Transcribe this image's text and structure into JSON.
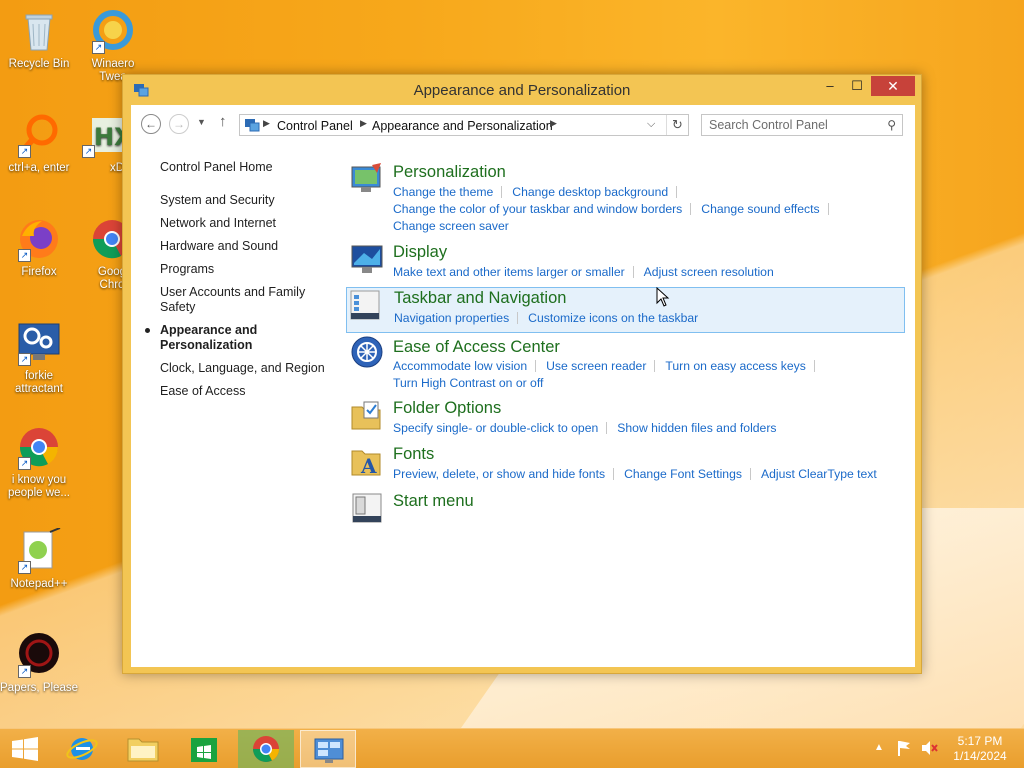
{
  "desktop": {
    "icons": [
      {
        "label": "Recycle Bin"
      },
      {
        "label": "Winaero Twea"
      },
      {
        "label": "ctrl+a, enter"
      },
      {
        "label": "xD"
      },
      {
        "label": "Firefox"
      },
      {
        "label": "Goog Chro"
      },
      {
        "label": "forkie attractant"
      },
      {
        "label": "i know you people we..."
      },
      {
        "label": "Notepad++"
      },
      {
        "label": "Papers, Please"
      }
    ]
  },
  "window": {
    "title": "Appearance and Personalization",
    "buttons": {
      "minimize": "–",
      "maximize": "☐",
      "close": "✕"
    }
  },
  "navbar": {
    "breadcrumbs": [
      "Control Panel",
      "Appearance and Personalization"
    ],
    "search_placeholder": "Search Control Panel"
  },
  "sidebar": {
    "home": "Control Panel Home",
    "items": [
      {
        "label": "System and Security"
      },
      {
        "label": "Network and Internet"
      },
      {
        "label": "Hardware and Sound"
      },
      {
        "label": "Programs"
      },
      {
        "label": "User Accounts and Family Safety"
      },
      {
        "label": "Appearance and Personalization",
        "current": true
      },
      {
        "label": "Clock, Language, and Region"
      },
      {
        "label": "Ease of Access"
      }
    ]
  },
  "categories": [
    {
      "title": "Personalization",
      "icon": "personalization-icon",
      "links": [
        "Change the theme",
        "Change desktop background",
        "Change the color of your taskbar and window borders",
        "Change sound effects",
        "Change screen saver"
      ]
    },
    {
      "title": "Display",
      "icon": "display-icon",
      "links": [
        "Make text and other items larger or smaller",
        "Adjust screen resolution"
      ]
    },
    {
      "title": "Taskbar and Navigation",
      "icon": "taskbar-icon",
      "highlighted": true,
      "links": [
        "Navigation properties",
        "Customize icons on the taskbar"
      ]
    },
    {
      "title": "Ease of Access Center",
      "icon": "ease-of-access-icon",
      "links": [
        "Accommodate low vision",
        "Use screen reader",
        "Turn on easy access keys",
        "Turn High Contrast on or off"
      ]
    },
    {
      "title": "Folder Options",
      "icon": "folder-options-icon",
      "links": [
        "Specify single- or double-click to open",
        "Show hidden files and folders"
      ]
    },
    {
      "title": "Fonts",
      "icon": "fonts-icon",
      "links": [
        "Preview, delete, or show and hide fonts",
        "Change Font Settings",
        "Adjust ClearType text"
      ]
    },
    {
      "title": "Start menu",
      "icon": "start-menu-icon",
      "links": []
    }
  ],
  "taskbar": {
    "apps": [
      "start-button",
      "internet-explorer",
      "file-explorer",
      "store",
      "chrome",
      "control-panel"
    ],
    "clock": {
      "time": "5:17 PM",
      "date": "1/14/2024"
    }
  },
  "colors": {
    "accent": "#f3c553",
    "link": "#1b6ac9",
    "category_title": "#1e6f1e",
    "close_button": "#c7423a"
  }
}
